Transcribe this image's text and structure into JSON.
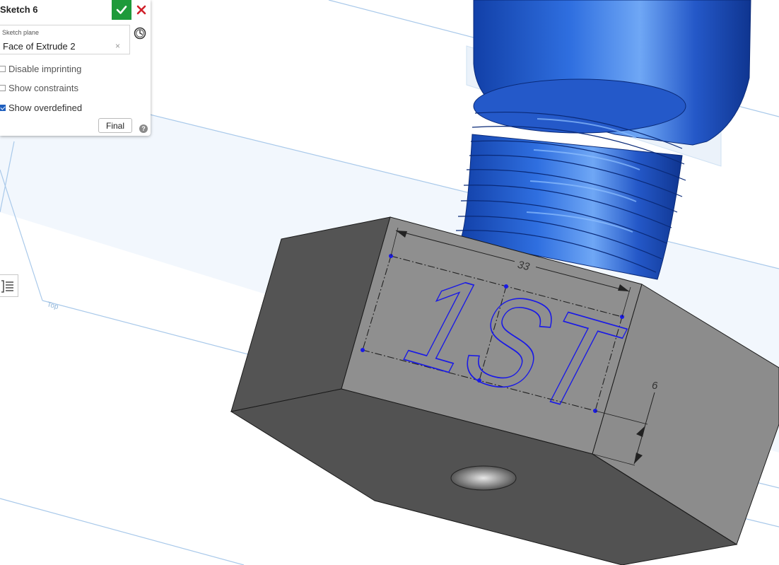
{
  "panel": {
    "title": "Sketch 6",
    "sketch_plane_label": "Sketch plane",
    "sketch_plane_value": "Face of Extrude 2",
    "clear_glyph": "×",
    "options": [
      {
        "label": "Disable imprinting",
        "checked": false
      },
      {
        "label": "Show constraints",
        "checked": false
      },
      {
        "label": "Show overdefined",
        "checked": true
      }
    ],
    "final_label": "Final",
    "help_glyph": "?"
  },
  "icons": {
    "accept": "check-icon",
    "cancel": "close-icon",
    "history": "clock-icon",
    "help": "help-icon",
    "list": "list-icon"
  },
  "viewport": {
    "plane_name": "Top",
    "sketch_text": "1ST",
    "dimension_width": "33",
    "dimension_height": "6"
  },
  "colors": {
    "accept_green": "#1e9a3a",
    "cancel_red": "#d0202a",
    "sketch_blue": "#1a1ae6",
    "part_blue": "#1f5fd6",
    "nut_gray": "#8c8c8c",
    "plane_blue": "#a9c9ea"
  }
}
